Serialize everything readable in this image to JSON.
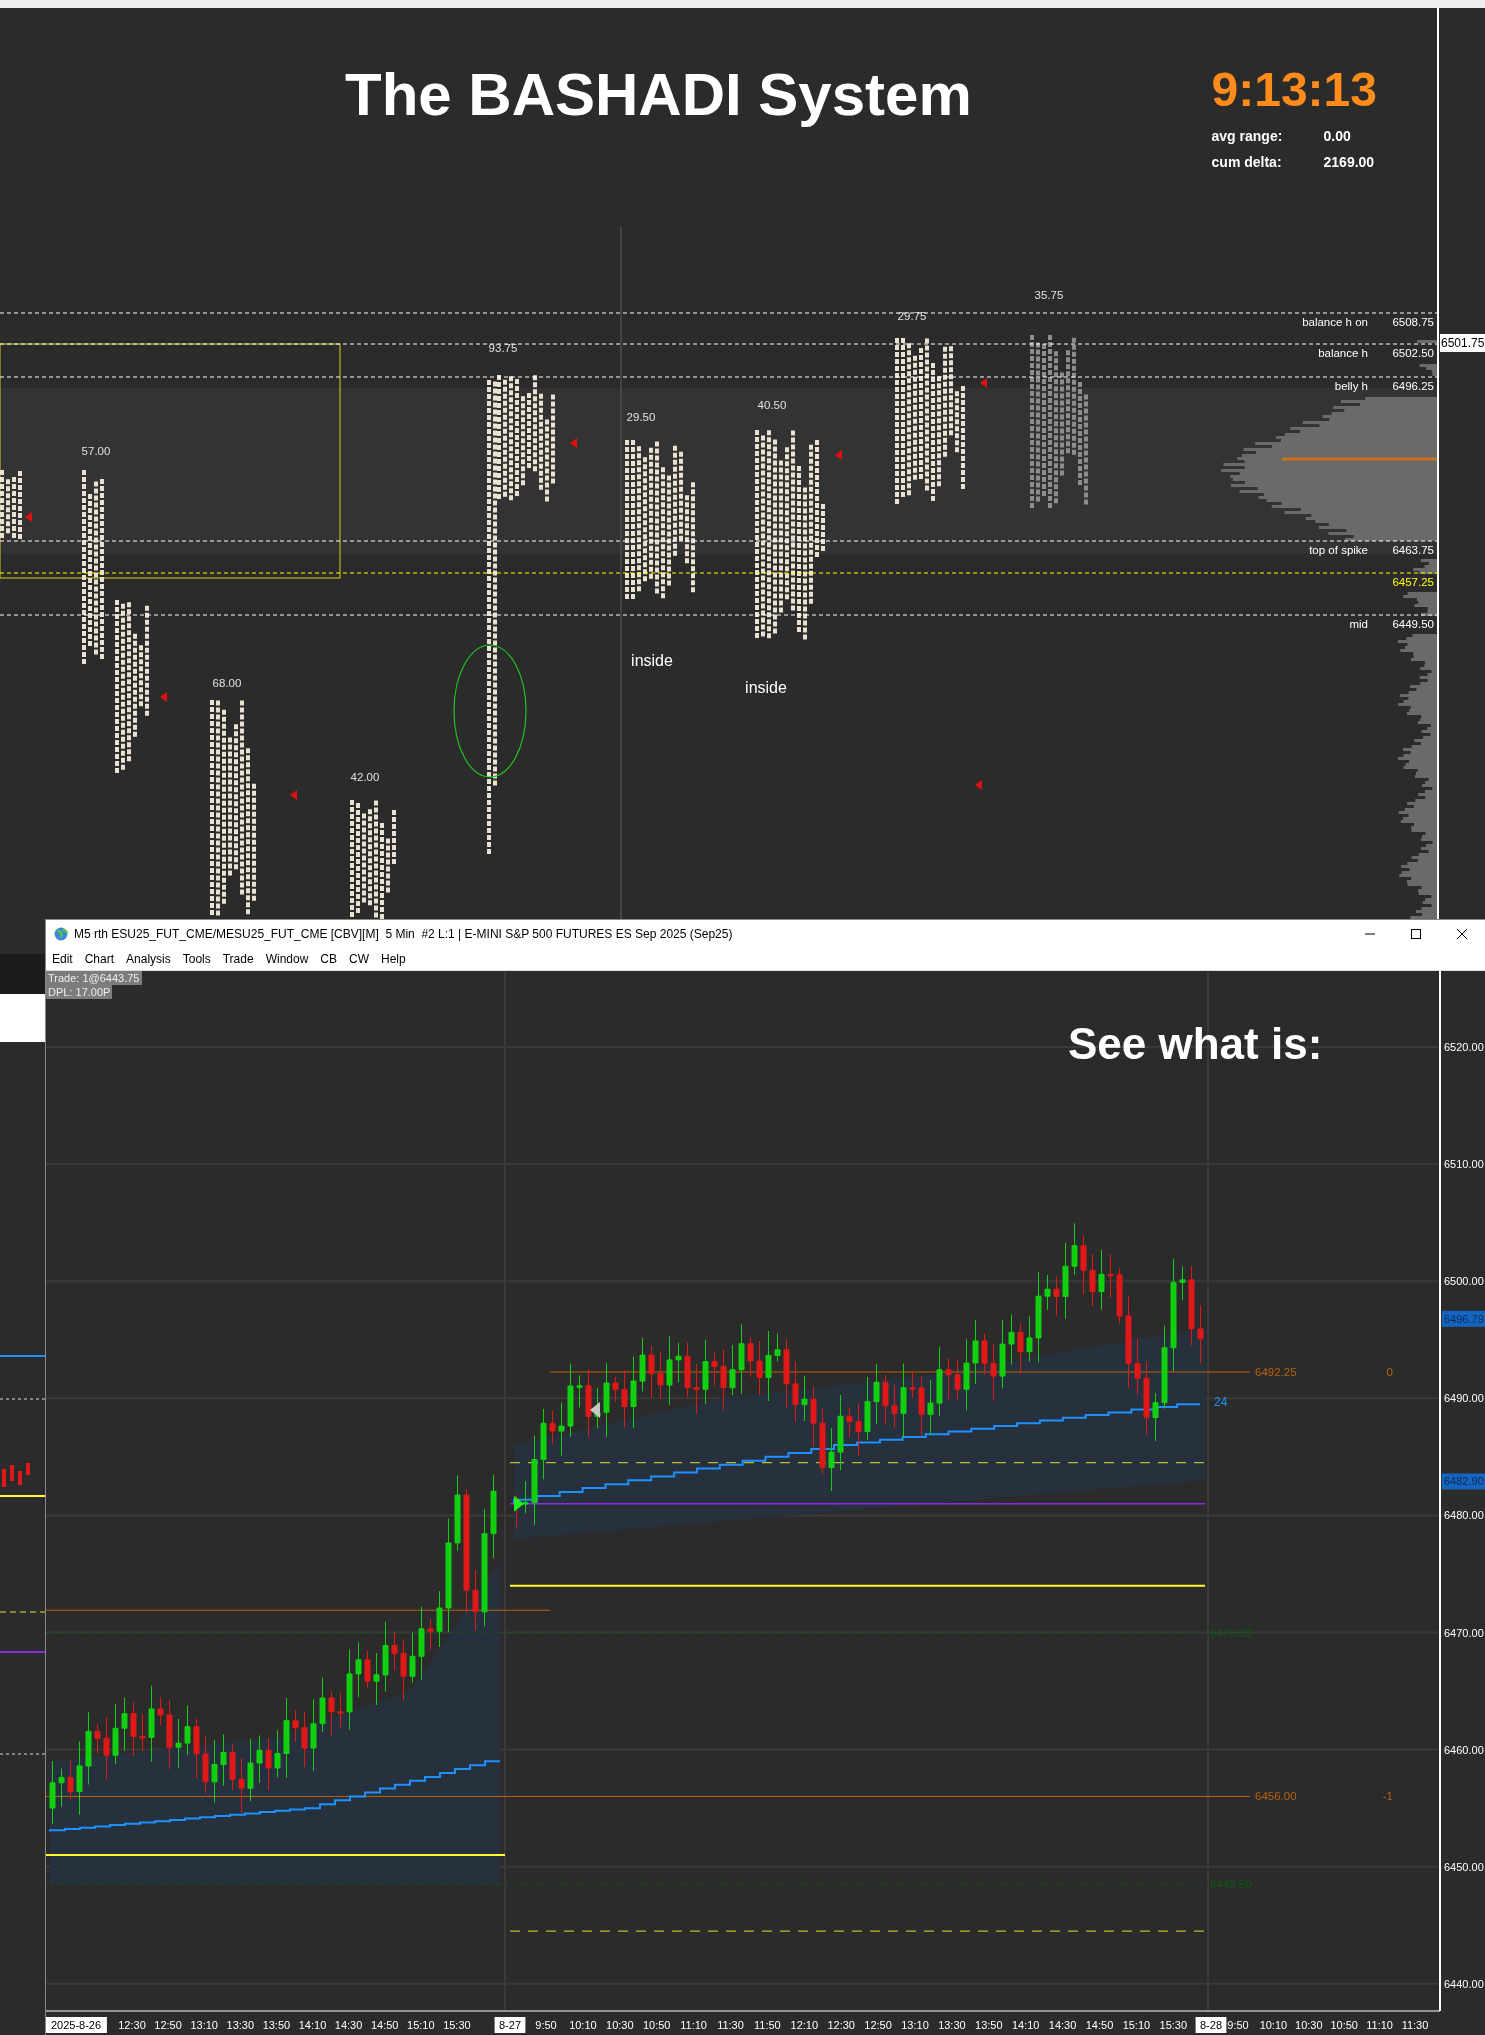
{
  "top_chart": {
    "title": "The BASHADI System",
    "clock": "9:13:13",
    "stats": [
      {
        "label": "avg range:",
        "value": "0.00"
      },
      {
        "label": "cum delta:",
        "value": "2169.00"
      }
    ],
    "levels": [
      {
        "label": "balance h on",
        "price": "6508.75",
        "color": "#ffffff"
      },
      {
        "label": "balance h",
        "price": "6502.50",
        "color": "#ffffff"
      },
      {
        "label": "belly h",
        "price": "6496.25",
        "color": "#ffffff"
      },
      {
        "label": "top of spike",
        "price": "6463.75",
        "color": "#ffffff"
      },
      {
        "price": "6457.25",
        "color": "#ffff00"
      },
      {
        "label": "mid",
        "price": "6449.50",
        "color": "#ffffff"
      }
    ],
    "price_tag": "6501.75",
    "range_labels": [
      "57.00",
      "93.75",
      "29.50",
      "40.50",
      "29.75",
      "35.75",
      "68.00",
      "42.00"
    ],
    "notes": [
      "inside",
      "inside"
    ]
  },
  "chart_window": {
    "title": "M5 rth ESU25_FUT_CME/MESU25_FUT_CME [CBV][M]  5 Min  #2 L:1 | E-MINI S&P 500 FUTURES ES Sep 2025 (Sep25)",
    "menu": [
      "Edit",
      "Chart",
      "Analysis",
      "Tools",
      "Trade",
      "Window",
      "CB",
      "CW",
      "Help"
    ],
    "info": [
      "Trade: 1@6443.75",
      "DPL: 17.00P"
    ],
    "headline": "See what is:",
    "price_axis": [
      "6520.00",
      "6510.00",
      "6500.00",
      "6490.00",
      "6480.00",
      "6470.00",
      "6460.00",
      "6450.00",
      "6440.00"
    ],
    "price_tags": [
      "6496.79",
      "6482.90"
    ],
    "level_labels": [
      {
        "text": "6492.25",
        "color": "#b8620e"
      },
      {
        "text": "6470.00",
        "color": "#0f5a0f"
      },
      {
        "text": "6456.00",
        "color": "#b8620e"
      },
      {
        "text": "6448.50",
        "color": "#0f5a0f"
      }
    ],
    "counters": [
      "0",
      "-1"
    ],
    "vwap_label": "24",
    "time_axis": [
      {
        "label": "2025-8-26",
        "kind": "date"
      },
      {
        "label": "12:30",
        "kind": "time"
      },
      {
        "label": "12:50",
        "kind": "time"
      },
      {
        "label": "13:10",
        "kind": "time"
      },
      {
        "label": "13:30",
        "kind": "time"
      },
      {
        "label": "13:50",
        "kind": "time"
      },
      {
        "label": "14:10",
        "kind": "time"
      },
      {
        "label": "14:30",
        "kind": "time"
      },
      {
        "label": "14:50",
        "kind": "time"
      },
      {
        "label": "15:10",
        "kind": "time"
      },
      {
        "label": "15:30",
        "kind": "time"
      },
      {
        "label": "8-27",
        "kind": "date"
      },
      {
        "label": "9:50",
        "kind": "time"
      },
      {
        "label": "10:10",
        "kind": "time"
      },
      {
        "label": "10:30",
        "kind": "time"
      },
      {
        "label": "10:50",
        "kind": "time"
      },
      {
        "label": "11:10",
        "kind": "time"
      },
      {
        "label": "11:30",
        "kind": "time"
      },
      {
        "label": "11:50",
        "kind": "time"
      },
      {
        "label": "12:10",
        "kind": "time"
      },
      {
        "label": "12:30",
        "kind": "time"
      },
      {
        "label": "12:50",
        "kind": "time"
      },
      {
        "label": "13:10",
        "kind": "time"
      },
      {
        "label": "13:30",
        "kind": "time"
      },
      {
        "label": "13:50",
        "kind": "time"
      },
      {
        "label": "14:10",
        "kind": "time"
      },
      {
        "label": "14:30",
        "kind": "time"
      },
      {
        "label": "14:50",
        "kind": "time"
      },
      {
        "label": "15:10",
        "kind": "time"
      },
      {
        "label": "15:30",
        "kind": "time"
      },
      {
        "label": "8-28",
        "kind": "date"
      },
      {
        "label": "9:50",
        "kind": "time"
      },
      {
        "label": "10:10",
        "kind": "time"
      },
      {
        "label": "10:30",
        "kind": "time"
      },
      {
        "label": "10:50",
        "kind": "time"
      },
      {
        "label": "11:10",
        "kind": "time"
      },
      {
        "label": "11:30",
        "kind": "time"
      }
    ]
  }
}
